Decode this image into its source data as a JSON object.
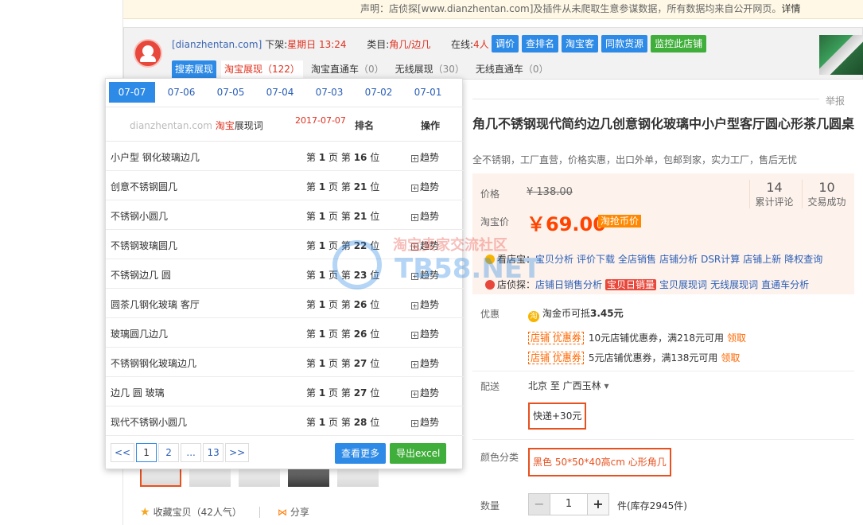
{
  "notice": {
    "text": "声明：店侦探[www.dianzhentan.com]及插件从未爬取生意参谋数据，所有数据均来自公开网页。",
    "link": "详情"
  },
  "toolbar": {
    "site": "[dianzhentan.com]",
    "offline_label": "下架:",
    "offline_value": "星期日 13:24",
    "category_label": "类目:",
    "category_value": "角几/边几",
    "online_label": "在线:",
    "online_value": "4人",
    "buttons": [
      "调价",
      "查排名",
      "淘宝客",
      "同款货源",
      "监控此店铺"
    ],
    "tabs": [
      {
        "label": "搜索展现",
        "count": ""
      },
      {
        "label": "淘宝展现",
        "count": "（122）"
      },
      {
        "label": "淘宝直通车",
        "count": "（0）"
      },
      {
        "label": "无线展现",
        "count": "（30）"
      },
      {
        "label": "无线直通车",
        "count": "（0）"
      }
    ]
  },
  "popup": {
    "dates": [
      "07-07",
      "07-06",
      "07-05",
      "07-04",
      "07-03",
      "07-02",
      "07-01"
    ],
    "brand_site": "dianzhentan.com",
    "brand_red": "淘宝",
    "brand_dark": "展现词",
    "date": "2017-07-07",
    "col_rank": "排名",
    "col_op": "操作",
    "rows": [
      {
        "kw": "小户型 钢化玻璃边几",
        "page": "1",
        "pos": "16"
      },
      {
        "kw": "创意不锈钢圆几",
        "page": "1",
        "pos": "21"
      },
      {
        "kw": "不锈钢小圆几",
        "page": "1",
        "pos": "21"
      },
      {
        "kw": "不锈钢玻璃圆几",
        "page": "1",
        "pos": "22"
      },
      {
        "kw": "不锈钢边几 圆",
        "page": "1",
        "pos": "23"
      },
      {
        "kw": "圆茶几钢化玻璃 客厅",
        "page": "1",
        "pos": "26"
      },
      {
        "kw": "玻璃圆几边几",
        "page": "1",
        "pos": "26"
      },
      {
        "kw": "不锈钢钢化玻璃边几",
        "page": "1",
        "pos": "27"
      },
      {
        "kw": "边几 圆 玻璃",
        "page": "1",
        "pos": "27"
      },
      {
        "kw": "现代不锈钢小圆几",
        "page": "1",
        "pos": "28"
      }
    ],
    "row_prefix": "第",
    "row_page_unit": "页 第",
    "row_pos_unit": "位",
    "trend_label": "趋势",
    "trend_box": "+",
    "pager": [
      "<<",
      "1",
      "2",
      "...",
      "13",
      ">>"
    ],
    "more_button": "查看更多",
    "export_button": "导出excel"
  },
  "product": {
    "report": "举报",
    "title": "角几不锈钢现代简约边几创意钢化玻璃中小户型客厅圆心形茶几圆桌",
    "subtitle": "全不锈钢，工厂直营，价格实惠，出口外单，包邮到家，实力工厂，售后无忧",
    "price_label": "价格",
    "old_price": "¥ 138.00",
    "tb_price_label": "淘宝价",
    "now_price": "￥69.00",
    "badge": "淘抢币价",
    "reviews_num": "14",
    "reviews_txt": "累计评论",
    "deals_num": "10",
    "deals_txt": "交易成功",
    "tool1_label": "看店宝：",
    "tool1_links": [
      "宝贝分析",
      "评价下载",
      "全店销售",
      "店铺分析",
      "DSR计算",
      "店铺上新",
      "降权查询"
    ],
    "tool2_label": "店侦探：",
    "tool2_links": [
      "店铺日销售分析",
      "宝贝日销量",
      "宝贝展现词",
      "无线展现词",
      "直通车分析"
    ],
    "promo_label": "优惠",
    "coin_icon": "淘",
    "coin_text": "淘金币可抵",
    "coin_value": "3.45元",
    "coupon_tag": "店铺 优惠券",
    "coupon1": "10元店铺优惠券，满218元可用",
    "coupon2": "5元店铺优惠券，满138元可用",
    "coupon_get": "领取",
    "ship_label": "配送",
    "ship_from": "北京 至",
    "ship_to": "广西玉林",
    "ship_arrow": "▾",
    "express": "快递+30元",
    "color_label": "颜色分类",
    "color_value": "黑色 50*50*40高cm 心形角几",
    "qty_label": "数量",
    "qty_minus": "−",
    "qty_value": "1",
    "qty_plus": "+",
    "stock": "件(库存2945件)",
    "fav": "收藏宝贝（42人气）",
    "fav_star": "★",
    "share": "分享",
    "share_icon": "⋈"
  },
  "watermark": {
    "cn": "淘宝卖家交流社区",
    "en": "TB58.NET"
  },
  "colors": {
    "accent_blue": "#2d8ae6",
    "accent_green": "#3fae3a",
    "price_orange": "#ff4400",
    "brand_red": "#e0301e"
  }
}
